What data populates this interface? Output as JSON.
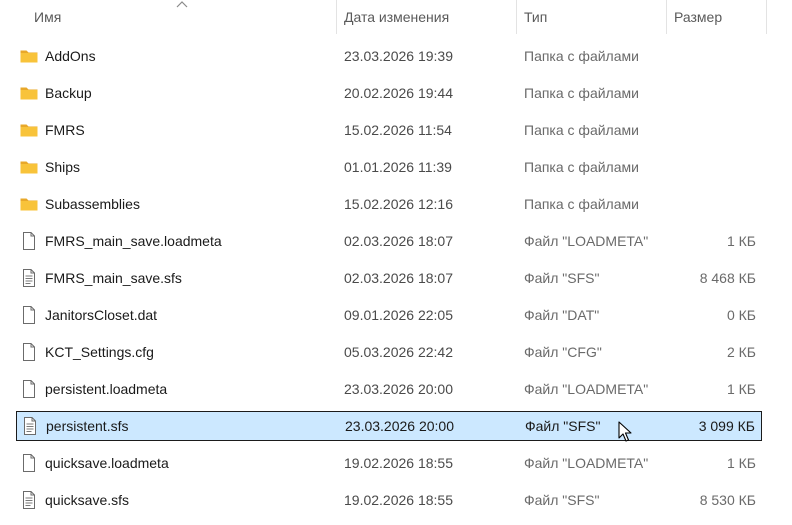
{
  "columns": {
    "name": "Имя",
    "date": "Дата изменения",
    "type": "Тип",
    "size": "Размер"
  },
  "files": [
    {
      "name": "AddOns",
      "date": "23.03.2026 19:39",
      "type": "Папка с файлами",
      "size": "",
      "icon": "folder-icon"
    },
    {
      "name": "Backup",
      "date": "20.02.2026 19:44",
      "type": "Папка с файлами",
      "size": "",
      "icon": "folder-icon"
    },
    {
      "name": "FMRS",
      "date": "15.02.2026 11:54",
      "type": "Папка с файлами",
      "size": "",
      "icon": "folder-icon"
    },
    {
      "name": "Ships",
      "date": "01.01.2026 11:39",
      "type": "Папка с файлами",
      "size": "",
      "icon": "folder-icon"
    },
    {
      "name": "Subassemblies",
      "date": "15.02.2026 12:16",
      "type": "Папка с файлами",
      "size": "",
      "icon": "folder-icon"
    },
    {
      "name": "FMRS_main_save.loadmeta",
      "date": "02.03.2026 18:07",
      "type": "Файл \"LOADMETA\"",
      "size": "1 КБ",
      "icon": "blank-file-icon"
    },
    {
      "name": "FMRS_main_save.sfs",
      "date": "02.03.2026 18:07",
      "type": "Файл \"SFS\"",
      "size": "8 468 КБ",
      "icon": "text-file-icon"
    },
    {
      "name": "JanitorsCloset.dat",
      "date": "09.01.2026 22:05",
      "type": "Файл \"DAT\"",
      "size": "0 КБ",
      "icon": "blank-file-icon"
    },
    {
      "name": "KCT_Settings.cfg",
      "date": "05.03.2026 22:42",
      "type": "Файл \"CFG\"",
      "size": "2 КБ",
      "icon": "blank-file-icon"
    },
    {
      "name": "persistent.loadmeta",
      "date": "23.03.2026 20:00",
      "type": "Файл \"LOADMETA\"",
      "size": "1 КБ",
      "icon": "blank-file-icon"
    },
    {
      "name": "persistent.sfs",
      "date": "23.03.2026 20:00",
      "type": "Файл \"SFS\"",
      "size": "3 099 КБ",
      "icon": "text-file-icon",
      "selected": true
    },
    {
      "name": "quicksave.loadmeta",
      "date": "19.02.2026 18:55",
      "type": "Файл \"LOADMETA\"",
      "size": "1 КБ",
      "icon": "blank-file-icon"
    },
    {
      "name": "quicksave.sfs",
      "date": "19.02.2026 18:55",
      "type": "Файл \"SFS\"",
      "size": "8 530 КБ",
      "icon": "text-file-icon"
    }
  ],
  "colors": {
    "selection_bg": "#cce8ff",
    "folder": "#f8c33a"
  }
}
